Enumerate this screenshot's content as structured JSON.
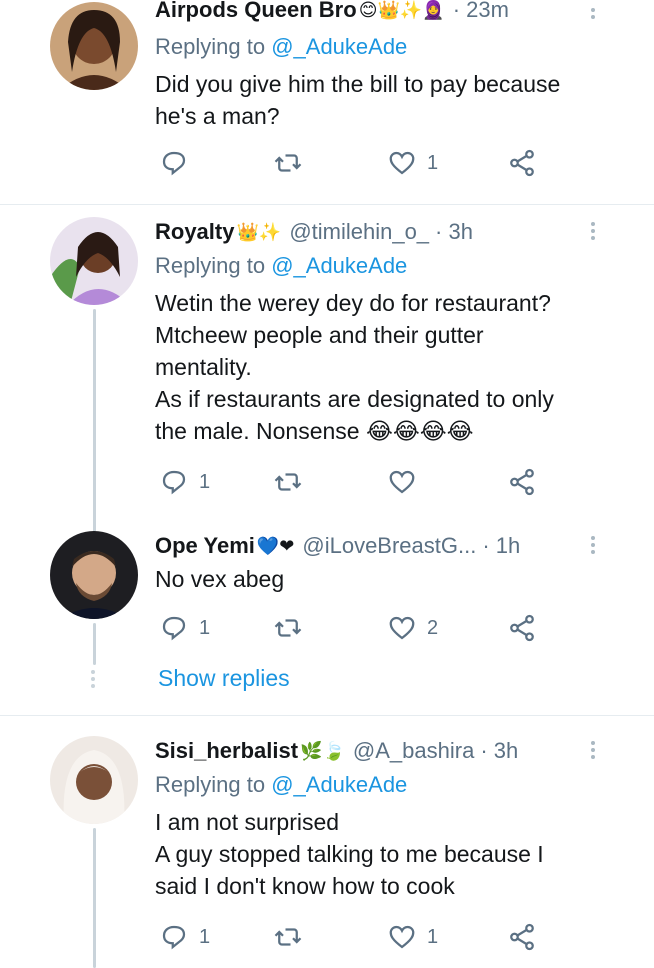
{
  "tweets": [
    {
      "name": "Airpods Queen Bro",
      "emojis": "😊👑✨🧕",
      "handle": "",
      "time": "· 23m",
      "replying_prefix": "Replying to",
      "replying_to": "@_AdukeAde",
      "lines": [
        "Did you give him the bill to pay because",
        "he's a man?"
      ],
      "replies": "",
      "likes": "1",
      "avatar_color": "#7a4a2e"
    },
    {
      "name": "Royalty",
      "emojis": "👑✨",
      "handle": "@timilehin_o_",
      "time": "· 3h",
      "replying_prefix": "Replying to",
      "replying_to": "@_AdukeAde",
      "lines": [
        "Wetin the werey dey do for restaurant?",
        "Mtcheew people and their gutter",
        "mentality.",
        "As if restaurants are designated to only",
        "the male. Nonsense 😂😂😂😂"
      ],
      "replies": "1",
      "likes": "",
      "avatar_color": "#9b6bc7"
    },
    {
      "name": "Ope Yemi",
      "emojis": "💙❤",
      "handle": "@iLoveBreastG...",
      "time": "· 1h",
      "lines": [
        "No vex abeg"
      ],
      "replies": "1",
      "likes": "2",
      "show_replies": "Show replies",
      "avatar_color": "#5a4030"
    },
    {
      "name": "Sisi_herbalist",
      "emojis": "🌿🍃",
      "handle": "@A_bashira",
      "time": "· 3h",
      "replying_prefix": "Replying to",
      "replying_to": "@_AdukeAde",
      "lines": [
        "I am not surprised",
        "A guy stopped talking to me because I",
        "said I don't know how to cook"
      ],
      "replies": "1",
      "likes": "1",
      "avatar_color": "#e8e2dc"
    }
  ],
  "colors": {
    "link": "#1b95e0",
    "secondary_text": "#5b7083",
    "divider": "#e6ecf0"
  },
  "icons": [
    "reply-icon",
    "retweet-icon",
    "like-icon",
    "share-icon",
    "more-icon"
  ]
}
